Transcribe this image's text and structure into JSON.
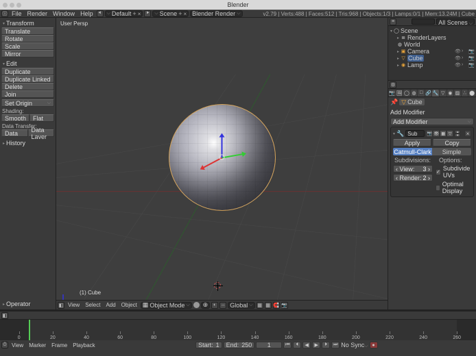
{
  "app": {
    "title": "Blender"
  },
  "topbar": {
    "menus": [
      "File",
      "Render",
      "Window",
      "Help"
    ],
    "layout": "Default",
    "scene": "Scene",
    "render_engine": "Blender Render",
    "stats": "v2.79 | Verts:488 | Faces:512 | Tris:968 | Objects:1/3 | Lamps:0/1 | Mem:13.24M | Cube"
  },
  "toolshelf": {
    "transform": {
      "header": "Transform",
      "items": [
        "Translate",
        "Rotate",
        "Scale",
        "Mirror"
      ]
    },
    "edit": {
      "header": "Edit",
      "items": [
        "Duplicate",
        "Duplicate Linked",
        "Delete",
        "Join"
      ],
      "set_origin": "Set Origin"
    },
    "shading_label": "Shading:",
    "shading": [
      "Smooth",
      "Flat"
    ],
    "data_transfer_label": "Data Transfer:",
    "data_transfer": [
      "Data",
      "Data Layer"
    ],
    "history": "History",
    "operator": "Operator"
  },
  "viewport": {
    "corner": "User Persp",
    "object_label": "(1) Cube",
    "header_menus": [
      "View",
      "Select",
      "Add",
      "Object"
    ],
    "mode": "Object Mode",
    "orientation": "Global"
  },
  "outliner": {
    "search_placeholder": "",
    "filter": "All Scenes",
    "tree": [
      {
        "indent": 0,
        "name": "Scene",
        "icon": "scene"
      },
      {
        "indent": 1,
        "name": "RenderLayers",
        "icon": "layers"
      },
      {
        "indent": 1,
        "name": "World",
        "icon": "world"
      },
      {
        "indent": 1,
        "name": "Camera",
        "icon": "camera",
        "active": false
      },
      {
        "indent": 1,
        "name": "Cube",
        "icon": "mesh",
        "active": true
      },
      {
        "indent": 1,
        "name": "Lamp",
        "icon": "lamp"
      }
    ]
  },
  "properties": {
    "context": "Cube",
    "modifier_panel": "Add Modifier",
    "modifier_name": "Sub",
    "apply": "Apply",
    "copy": "Copy",
    "method": {
      "active": "Catmull-Clark",
      "other": "Simple"
    },
    "subdiv_label": "Subdivisions:",
    "options_label": "Options:",
    "view_label": "View:",
    "view_value": "3",
    "render_label": "Render:",
    "render_value": "2",
    "opt_uvs": "Subdivide UVs",
    "opt_uvs_checked": true,
    "opt_display": "Optimal Display",
    "opt_display_checked": false
  },
  "timeline": {
    "menus": [
      "View",
      "Marker",
      "Frame",
      "Playback"
    ],
    "start_label": "Start:",
    "start": "1",
    "end_label": "End:",
    "end": "250",
    "cur": "1",
    "sync": "No Sync",
    "ticks": [
      "0",
      "20",
      "40",
      "60",
      "80",
      "100",
      "120",
      "140",
      "160",
      "180",
      "200",
      "220",
      "240",
      "260"
    ]
  }
}
